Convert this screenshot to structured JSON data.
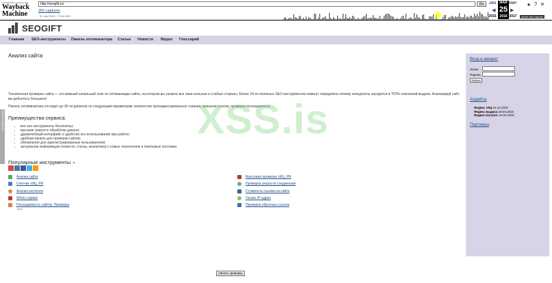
{
  "wayback": {
    "logo_top": "INTERNET ARCHIVE",
    "logo_main": "Wayback Machine",
    "url": "http://seogift.ru/",
    "go": "Go",
    "captures": "352 captures",
    "range": "21 Jan 2015 - 7 Oct 2022",
    "months": [
      "JAN",
      "MAR",
      "MAY"
    ],
    "years": [
      "2015",
      "2016",
      "2017"
    ],
    "day": "25",
    "about": "About this capture"
  },
  "site": {
    "logo": "SEOGIFT",
    "nav": [
      "Главная",
      "SEO-инструменты",
      "Панель оптимизатора",
      "Статьи",
      "Новости",
      "Видео",
      "Глоссарий"
    ],
    "title": "Анализ сайта",
    "intro": "Техническая проверка сайта — это важный начальный этап по оптимизации сайта, на котором вы узнаете все свои сильные и слабые стороны. Более 29-ти полезных SEO-инструментов помогут определить почему конкуренты находятся в ТОПе поисковой выдачи. Анализируй сайт, вы добьетесь большего!",
    "panel": "Панель оптимизатора отследит до 30-ти доменов по следующим параметрам: количество проиндексированных страниц, внешние ссылки, проверка посещаемости.",
    "advantages_title": "Преимущества сервиса:",
    "advantages": [
      "все seo-инструменты бесплатны;",
      "высокая скорость обработки данных;",
      "дружелюбный интерфейс и удобство его использования при работе;",
      "удобная панель для проверки сайтов;",
      "обновления для зарегистрированных пользователей;",
      "актуальная информация (новости, статьи, аналитика) о новых технологиях в поисковых системах."
    ],
    "tools_title": "Популярные инструменты",
    "tools_left": [
      "Анализ сайта",
      "Счетчик тИЦ, PR",
      "Анализ контента",
      "Whois сервис",
      "Посещаемость сайтов. Проверка"
    ],
    "tools_left_sub": "Таро",
    "tools_right": [
      "Массовая проверка тИЦ, PR",
      "Проверка скорости соединения",
      "Стоимость ссылки на сайте",
      "Узнать IP-адрес",
      "Проверка обратных ссылок"
    ],
    "start_button": "Начать проверку",
    "watermark": "XSS.is",
    "feedback": "Оставить отзыв"
  },
  "sidebar": {
    "login_title": "Вход в аккаунт",
    "login_label": "Логин",
    "password_label": "Пароль",
    "login_button": "Войти",
    "updates_title": "Апдейты",
    "updates": [
      {
        "label": "Яндекс тИЦ",
        "date": "22.12.2015"
      },
      {
        "label": "Яндекс выдача",
        "date": "18.03.2016"
      },
      {
        "label": "Яндекс Каталог",
        "date": "24.03.2016"
      }
    ],
    "partners": "Партнеры"
  },
  "colors": {
    "nav_bg": "#d8d3e6",
    "link": "#1a4a8a",
    "watermark": "#78d278"
  }
}
